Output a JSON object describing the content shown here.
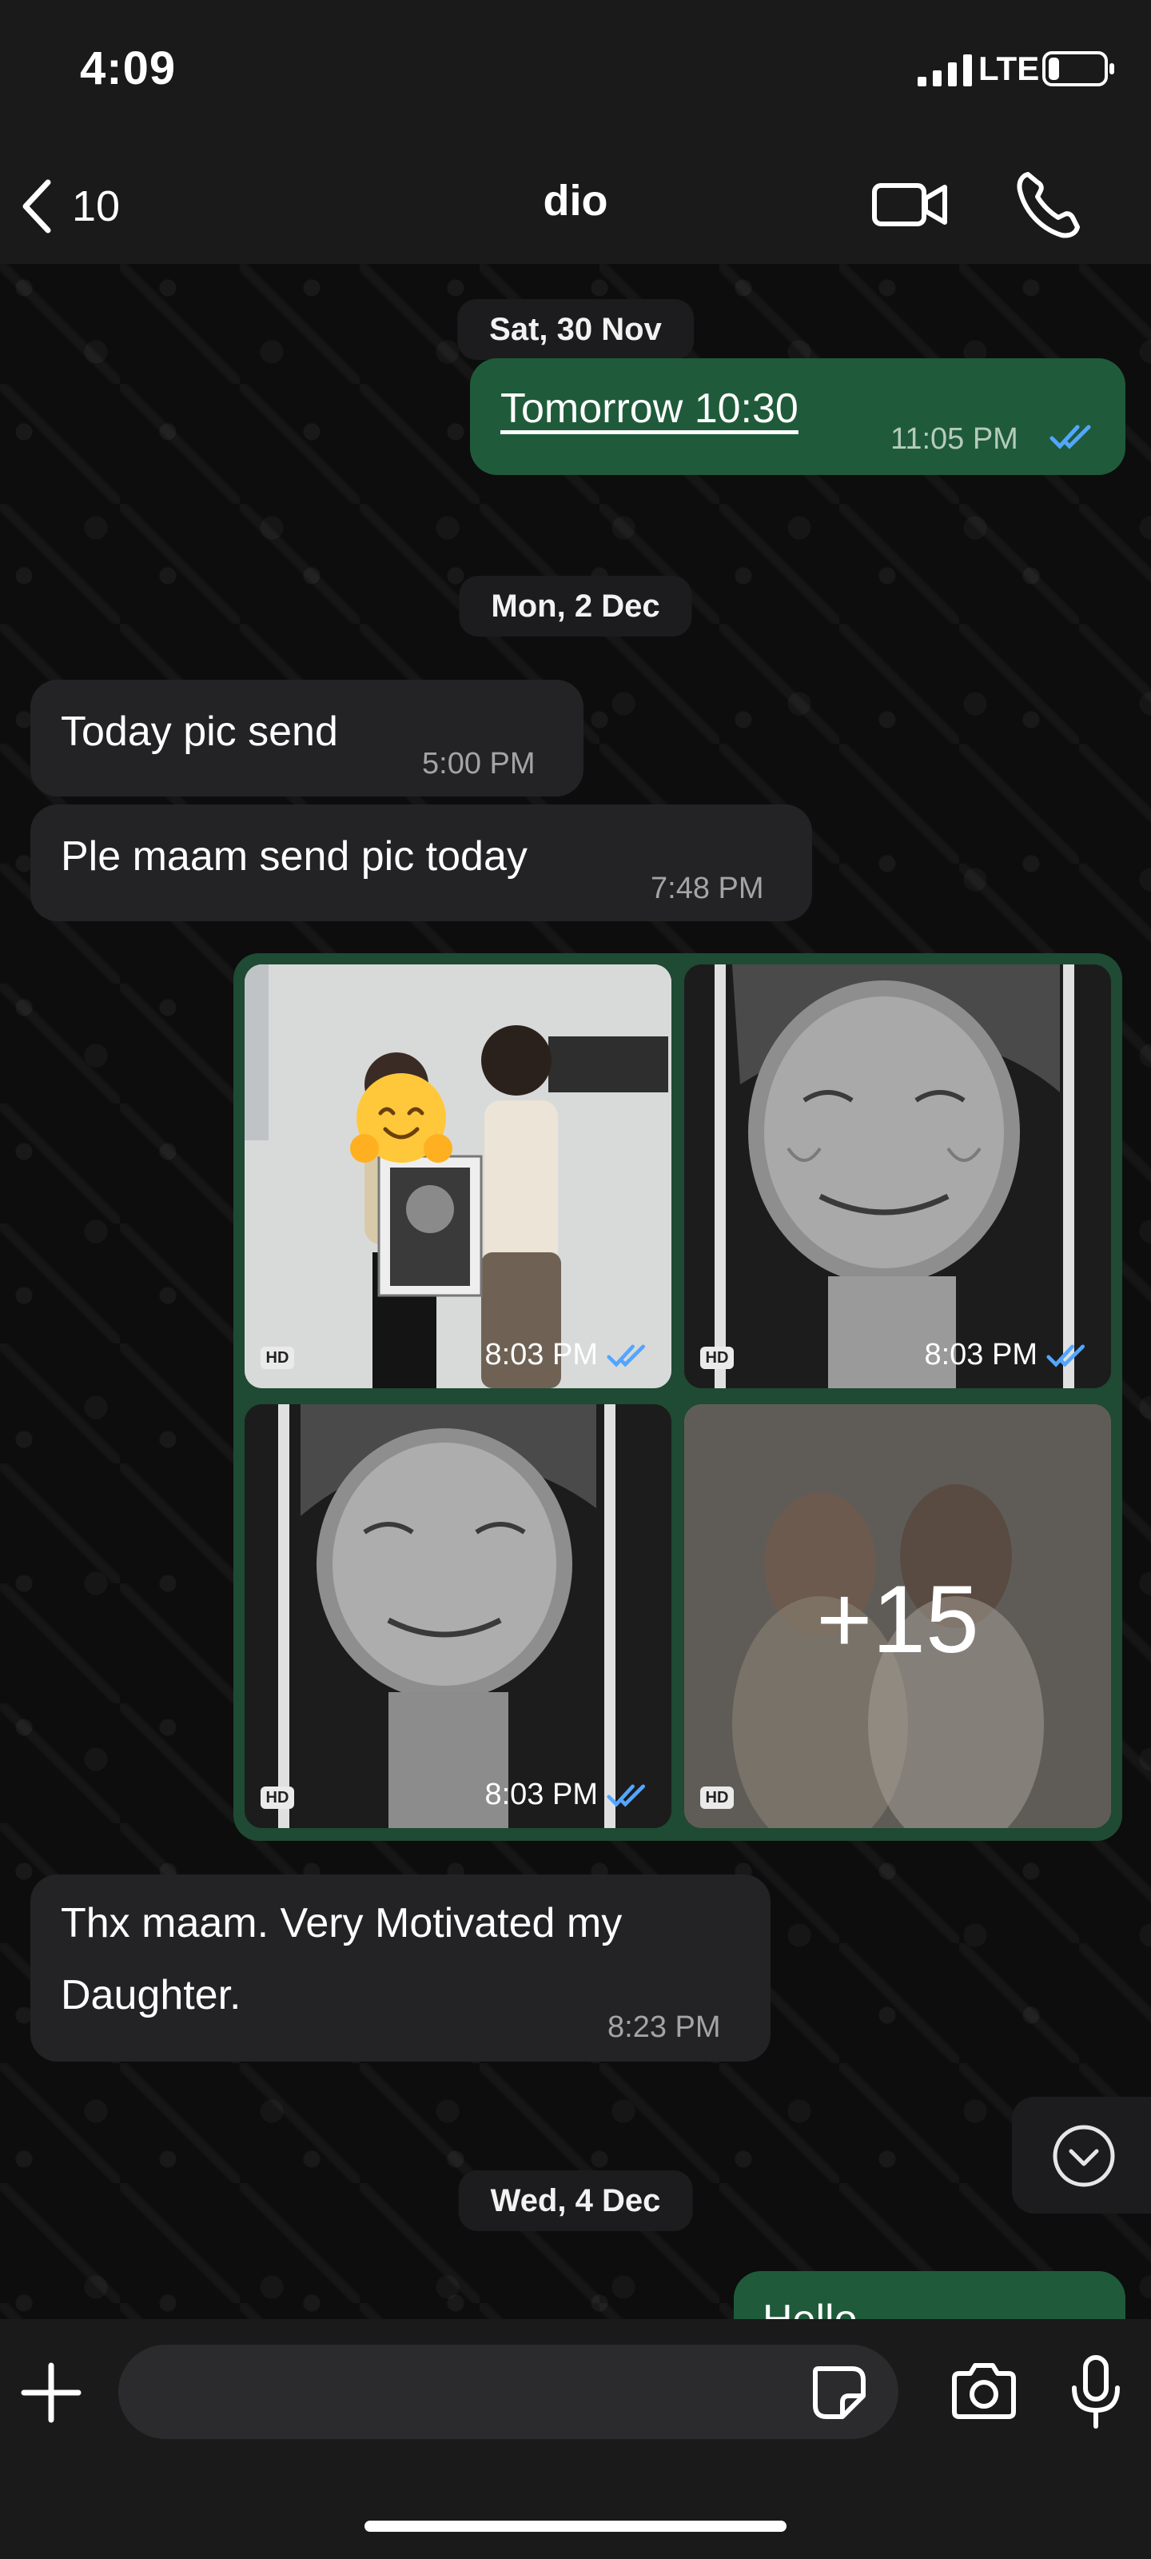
{
  "status_bar": {
    "time": "4:09",
    "network": "LTE",
    "battery_level": 0.2
  },
  "header": {
    "back_count": "10",
    "contact_name": "dio"
  },
  "chat": {
    "date_sat": "Sat, 30 Nov",
    "msg_tomorrow": {
      "text": "Tomorrow 10:30",
      "time": "11:05 PM"
    },
    "date_mon": "Mon, 2 Dec",
    "msg_today_pic": {
      "text": "Today pic send",
      "time": "5:00 PM"
    },
    "msg_ple_maam": {
      "text": "Ple maam  send pic today",
      "time": "7:48 PM"
    },
    "photos": [
      {
        "time": "8:03 PM",
        "badge": "HD"
      },
      {
        "time": "8:03 PM",
        "badge": "HD"
      },
      {
        "time": "8:03 PM",
        "badge": "HD"
      },
      {
        "badge": "HD",
        "overlay": "+15"
      }
    ],
    "msg_thx": {
      "line1": "Thx maam. Very Motivated  my",
      "line2": "Daughter.",
      "time": "8:23 PM"
    },
    "date_wed": "Wed, 4 Dec",
    "msg_hello": {
      "text": "Hello"
    }
  },
  "input": {
    "placeholder": ""
  },
  "colors": {
    "outgoing_bubble": "#1f5b3a",
    "incoming_bubble": "#232325",
    "read_ticks": "#53a6ff"
  }
}
